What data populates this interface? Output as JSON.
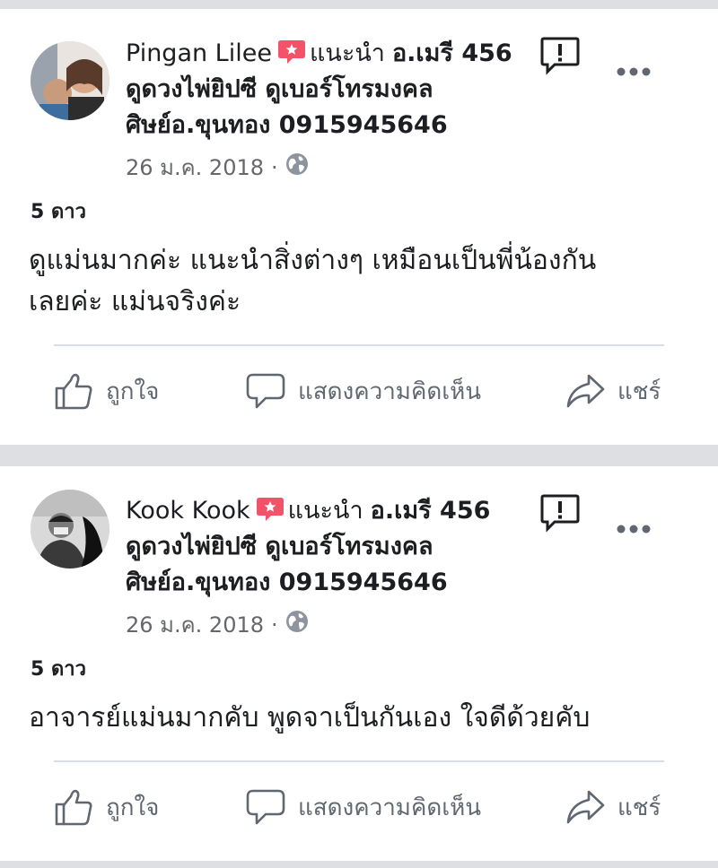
{
  "reviews": [
    {
      "author": "Pingan Lilee",
      "recommends": "แนะนำ",
      "page_name": "อ.เมรี 456",
      "page_line2": "ดูดวงไพ่ยิปซี ดูเบอร์โทรมงคล",
      "page_line3": "ศิษย์อ.ขุนทอง 0915945646",
      "date": "26 ม.ค. 2018",
      "separator": "·",
      "rating": "5 ดาว",
      "text_line1": "ดูแม่นมากค่ะ แนะนำสิ่งต่างๆ เหมือนเป็นพี่น้องกัน",
      "text_line2": "เลยค่ะ แม่นจริงค่ะ",
      "like_label": "ถูกใจ",
      "comment_label": "แสดงความคิดเห็น",
      "share_label": "แชร์"
    },
    {
      "author": "Kook Kook",
      "recommends": "แนะนำ",
      "page_name": "อ.เมรี 456",
      "page_line2": "ดูดวงไพ่ยิปซี ดูเบอร์โทรมงคล",
      "page_line3": "ศิษย์อ.ขุนทอง 0915945646",
      "date": "26 ม.ค. 2018",
      "separator": "·",
      "rating": "5 ดาว",
      "text_line1": "อาจารย์แม่นมากคับ พูดจาเป็นกันเอง ใจดีด้วยคับ",
      "text_line2": "",
      "like_label": "ถูกใจ",
      "comment_label": "แสดงความคิดเห็น",
      "share_label": "แชร์"
    }
  ],
  "icons": {
    "recommend": "recommend-badge-icon",
    "report": "report-icon",
    "more": "more-options-icon",
    "privacy": "globe-icon",
    "like": "thumbs-up-icon",
    "comment": "comment-bubble-icon",
    "share": "share-arrow-icon"
  },
  "colors": {
    "recommend_badge": "#f35369",
    "secondary_text": "#65676b",
    "action_text": "#606770",
    "divider": "#dadde1",
    "feed_background": "#dddfe2"
  }
}
